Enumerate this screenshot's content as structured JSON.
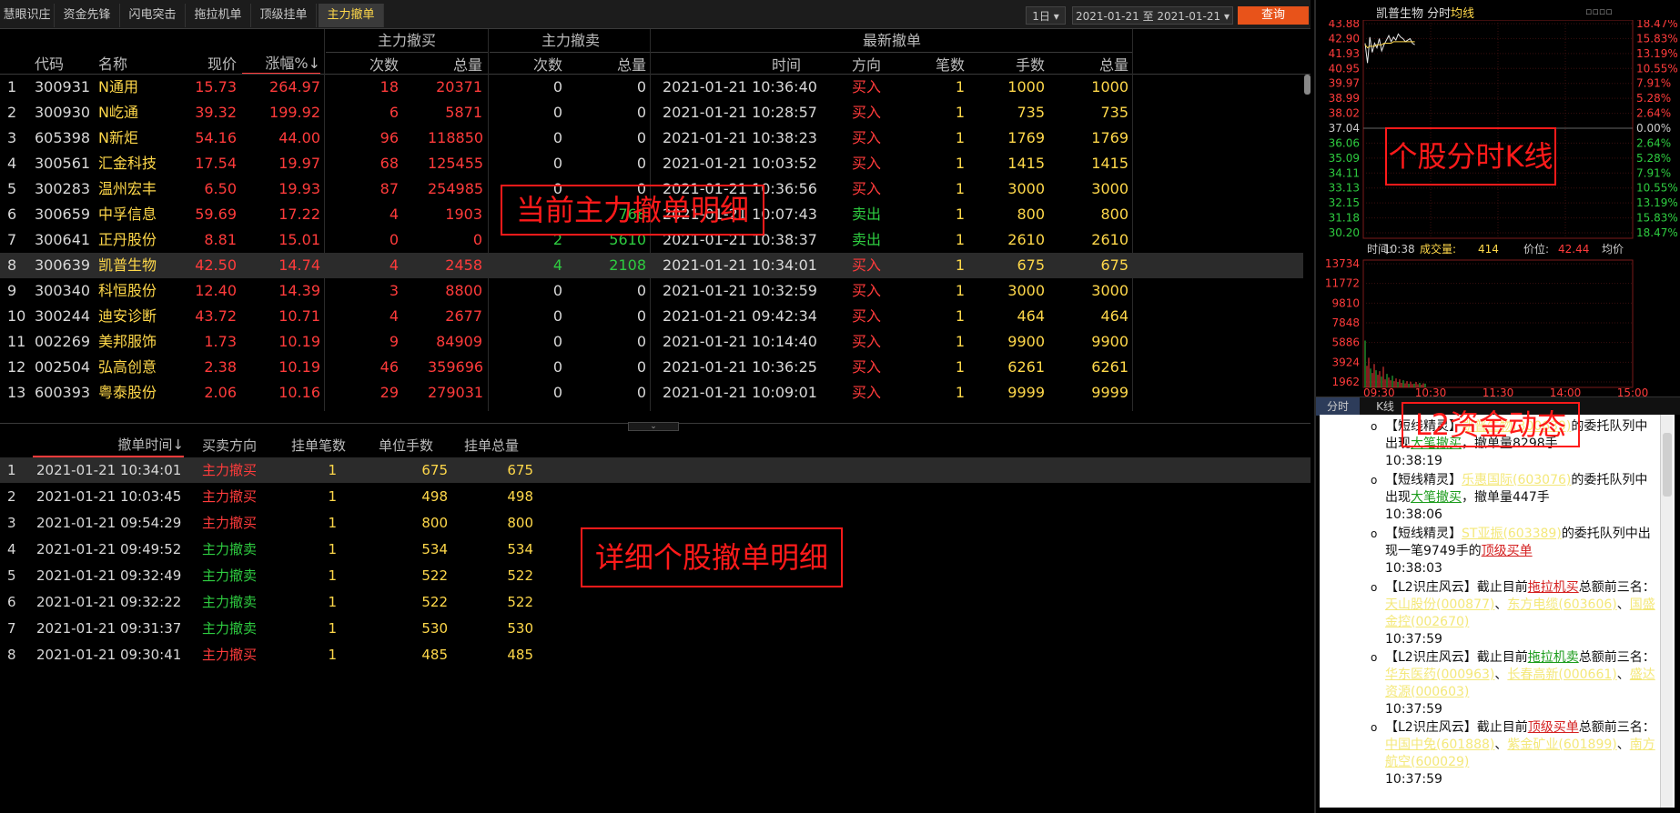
{
  "tabs": [
    "慧眼识庄",
    "资金先锋",
    "闪电突击",
    "拖拉机单",
    "顶级挂单",
    "主力撤单"
  ],
  "toolbar": {
    "period": "1日",
    "date_from": "2021-01-21",
    "date_sep": "至",
    "date_to": "2021-01-21",
    "query": "查询"
  },
  "main_table": {
    "groups": [
      "主力撤买",
      "主力撤卖",
      "最新撤单"
    ],
    "headers": [
      "代码",
      "名称",
      "现价",
      "涨幅%↓",
      "次数",
      "总量",
      "次数",
      "总量",
      "时间",
      "方向",
      "笔数",
      "手数",
      "总量"
    ],
    "rows": [
      {
        "idx": "1",
        "code": "300931",
        "name": "N通用",
        "price": "15.73",
        "chg": "264.97",
        "bn": "18",
        "bv": "20371",
        "sn": "0",
        "sv": "0",
        "time": "2021-01-21 10:36:40",
        "dir": "买入",
        "cnt": "1",
        "lots": "1000",
        "tot": "1000"
      },
      {
        "idx": "2",
        "code": "300930",
        "name": "N屹通",
        "price": "39.32",
        "chg": "199.92",
        "bn": "6",
        "bv": "5871",
        "sn": "0",
        "sv": "0",
        "time": "2021-01-21 10:28:57",
        "dir": "买入",
        "cnt": "1",
        "lots": "735",
        "tot": "735"
      },
      {
        "idx": "3",
        "code": "605398",
        "name": "N新炬",
        "price": "54.16",
        "chg": "44.00",
        "bn": "96",
        "bv": "118850",
        "sn": "0",
        "sv": "0",
        "time": "2021-01-21 10:38:23",
        "dir": "买入",
        "cnt": "1",
        "lots": "1769",
        "tot": "1769"
      },
      {
        "idx": "4",
        "code": "300561",
        "name": "汇金科技",
        "price": "17.54",
        "chg": "19.97",
        "bn": "68",
        "bv": "125455",
        "sn": "0",
        "sv": "0",
        "time": "2021-01-21 10:03:52",
        "dir": "买入",
        "cnt": "1",
        "lots": "1415",
        "tot": "1415"
      },
      {
        "idx": "5",
        "code": "300283",
        "name": "温州宏丰",
        "price": "6.50",
        "chg": "19.93",
        "bn": "87",
        "bv": "254985",
        "sn": "0",
        "sv": "0",
        "time": "2021-01-21 10:36:56",
        "dir": "买入",
        "cnt": "1",
        "lots": "3000",
        "tot": "3000"
      },
      {
        "idx": "6",
        "code": "300659",
        "name": "中孚信息",
        "price": "59.69",
        "chg": "17.22",
        "bn": "4",
        "bv": "1903",
        "sn": "",
        "sv": "768",
        "time": "2021-01-21 10:07:43",
        "dir": "卖出",
        "cnt": "1",
        "lots": "800",
        "tot": "800"
      },
      {
        "idx": "7",
        "code": "300641",
        "name": "正丹股份",
        "price": "8.81",
        "chg": "15.01",
        "bn": "0",
        "bv": "0",
        "sn": "2",
        "sv": "5610",
        "time": "2021-01-21 10:38:37",
        "dir": "卖出",
        "cnt": "1",
        "lots": "2610",
        "tot": "2610"
      },
      {
        "idx": "8",
        "code": "300639",
        "name": "凯普生物",
        "price": "42.50",
        "chg": "14.74",
        "bn": "4",
        "bv": "2458",
        "sn": "4",
        "sv": "2108",
        "time": "2021-01-21 10:34:01",
        "dir": "买入",
        "cnt": "1",
        "lots": "675",
        "tot": "675"
      },
      {
        "idx": "9",
        "code": "300340",
        "name": "科恒股份",
        "price": "12.40",
        "chg": "14.39",
        "bn": "3",
        "bv": "8800",
        "sn": "0",
        "sv": "0",
        "time": "2021-01-21 10:32:59",
        "dir": "买入",
        "cnt": "1",
        "lots": "3000",
        "tot": "3000"
      },
      {
        "idx": "10",
        "code": "300244",
        "name": "迪安诊断",
        "price": "43.72",
        "chg": "10.71",
        "bn": "4",
        "bv": "2677",
        "sn": "0",
        "sv": "0",
        "time": "2021-01-21 09:42:34",
        "dir": "买入",
        "cnt": "1",
        "lots": "464",
        "tot": "464"
      },
      {
        "idx": "11",
        "code": "002269",
        "name": "美邦服饰",
        "price": "1.73",
        "chg": "10.19",
        "bn": "9",
        "bv": "84909",
        "sn": "0",
        "sv": "0",
        "time": "2021-01-21 10:14:40",
        "dir": "买入",
        "cnt": "1",
        "lots": "9900",
        "tot": "9900"
      },
      {
        "idx": "12",
        "code": "002504",
        "name": "弘高创意",
        "price": "2.38",
        "chg": "10.19",
        "bn": "46",
        "bv": "359696",
        "sn": "0",
        "sv": "0",
        "time": "2021-01-21 10:36:25",
        "dir": "买入",
        "cnt": "1",
        "lots": "6261",
        "tot": "6261"
      },
      {
        "idx": "13",
        "code": "600393",
        "name": "粤泰股份",
        "price": "2.06",
        "chg": "10.16",
        "bn": "29",
        "bv": "279031",
        "sn": "0",
        "sv": "0",
        "time": "2021-01-21 10:09:01",
        "dir": "买入",
        "cnt": "1",
        "lots": "9999",
        "tot": "9999"
      }
    ]
  },
  "detail_table": {
    "headers": [
      "撤单时间↓",
      "买卖方向",
      "挂单笔数",
      "单位手数",
      "挂单总量"
    ],
    "rows": [
      {
        "idx": "1",
        "time": "2021-01-21 10:34:01",
        "dir": "主力撤买",
        "cnt": "1",
        "unit": "675",
        "tot": "675"
      },
      {
        "idx": "2",
        "time": "2021-01-21 10:03:45",
        "dir": "主力撤买",
        "cnt": "1",
        "unit": "498",
        "tot": "498"
      },
      {
        "idx": "3",
        "time": "2021-01-21 09:54:29",
        "dir": "主力撤买",
        "cnt": "1",
        "unit": "800",
        "tot": "800"
      },
      {
        "idx": "4",
        "time": "2021-01-21 09:49:52",
        "dir": "主力撤卖",
        "cnt": "1",
        "unit": "534",
        "tot": "534"
      },
      {
        "idx": "5",
        "time": "2021-01-21 09:32:49",
        "dir": "主力撤卖",
        "cnt": "1",
        "unit": "522",
        "tot": "522"
      },
      {
        "idx": "6",
        "time": "2021-01-21 09:32:22",
        "dir": "主力撤卖",
        "cnt": "1",
        "unit": "522",
        "tot": "522"
      },
      {
        "idx": "7",
        "time": "2021-01-21 09:31:37",
        "dir": "主力撤卖",
        "cnt": "1",
        "unit": "530",
        "tot": "530"
      },
      {
        "idx": "8",
        "time": "2021-01-21 09:30:41",
        "dir": "主力撤买",
        "cnt": "1",
        "unit": "485",
        "tot": "485"
      }
    ]
  },
  "annotations": {
    "main": "当前主力撤单明细",
    "detail": "详细个股撤单明细",
    "kline": "个股分时K线",
    "l2": "L2资金动态"
  },
  "chart": {
    "title": "凯普生物 分时",
    "avg_label": "均线",
    "price_ticks": [
      "43.88",
      "42.90",
      "41.93",
      "40.95",
      "39.97",
      "38.99",
      "38.02",
      "37.04",
      "36.06",
      "35.09",
      "34.11",
      "33.13",
      "32.15",
      "31.18",
      "30.20"
    ],
    "pct_ticks": [
      "18.47%",
      "15.83%",
      "13.19%",
      "10.55%",
      "7.91%",
      "5.28%",
      "2.64%",
      "0.00%",
      "2.64%",
      "5.28%",
      "7.91%",
      "10.55%",
      "13.19%",
      "15.83%",
      "18.47%"
    ],
    "info": {
      "time_label": "时间:",
      "time": "10:38",
      "vol_label": "成交量:",
      "vol": "414",
      "price_label": "价位:",
      "price": "42.44",
      "avg_label": "均价"
    },
    "vol_ticks": [
      "13734",
      "11772",
      "9810",
      "7848",
      "5886",
      "3924",
      "1962"
    ],
    "time_ticks": [
      "09:30",
      "10:30",
      "11:30",
      "14:00",
      "15:00"
    ],
    "price_series": [
      42.6,
      41.3,
      43.0,
      42.0,
      42.6,
      42.3,
      42.9,
      42.1,
      42.5,
      42.8,
      43.1,
      42.7,
      43.0,
      42.8,
      43.2,
      43.0,
      42.9,
      42.7,
      42.8,
      42.9,
      42.6,
      42.5
    ],
    "avg_series": [
      42.5,
      42.3,
      42.4,
      42.4,
      42.4,
      42.5,
      42.5,
      42.5,
      42.6,
      42.6,
      42.6,
      42.6,
      42.7,
      42.7,
      42.7,
      42.7,
      42.7,
      42.7,
      42.7,
      42.7,
      42.7,
      42.7
    ],
    "vol_series": [
      5200,
      2400,
      3300,
      2100,
      1600,
      2600,
      1900,
      1400,
      1800,
      1200,
      2300,
      900,
      1500,
      1100,
      800,
      1300,
      700,
      1000,
      600,
      900,
      500,
      800,
      450,
      700,
      400,
      650,
      380,
      420,
      600,
      350,
      500,
      300,
      450,
      414
    ]
  },
  "chart_buttons": [
    "分时",
    "K线"
  ],
  "l2_feed": [
    {
      "tag": "【短线精灵】",
      "stock": "凯普生物(300639)",
      "mid": "的委托队列中出现",
      "kw": "大笔撤买",
      "tail": "，撤单量8298手",
      "time": "10:38:19"
    },
    {
      "tag": "【短线精灵】",
      "stock": "乐惠国际(603076)",
      "mid": "的委托队列中出现",
      "kw": "大笔撤买",
      "tail": "，撤单量447手",
      "time": "10:38:06"
    },
    {
      "tag": "【短线精灵】",
      "stock": "ST亚振(603389)",
      "mid": "的委托队列中出现一笔9749手的",
      "kw": "顶级买单",
      "tail": "",
      "time": "10:38:03"
    },
    {
      "tag": "【L2识庄风云】",
      "pre": "截止目前",
      "kw": "拖拉机买",
      "post": "总额前三名：",
      "stocks": [
        "天山股份(000877)",
        "东方电缆(603606)",
        "国盛金控(002670)"
      ],
      "time": "10:37:59"
    },
    {
      "tag": "【L2识庄风云】",
      "pre": "截止目前",
      "kw": "拖拉机卖",
      "post": "总额前三名：",
      "stocks": [
        "华东医药(000963)",
        "长春高新(000661)",
        "盛达资源(000603)"
      ],
      "time": "10:37:59"
    },
    {
      "tag": "【L2识庄风云】",
      "pre": "截止目前",
      "kw": "顶级买单",
      "post": "总额前三名：",
      "stocks": [
        "中国中免(601888)",
        "紫金矿业(601899)",
        "南方航空(600029)"
      ],
      "time": "10:37:59"
    }
  ]
}
